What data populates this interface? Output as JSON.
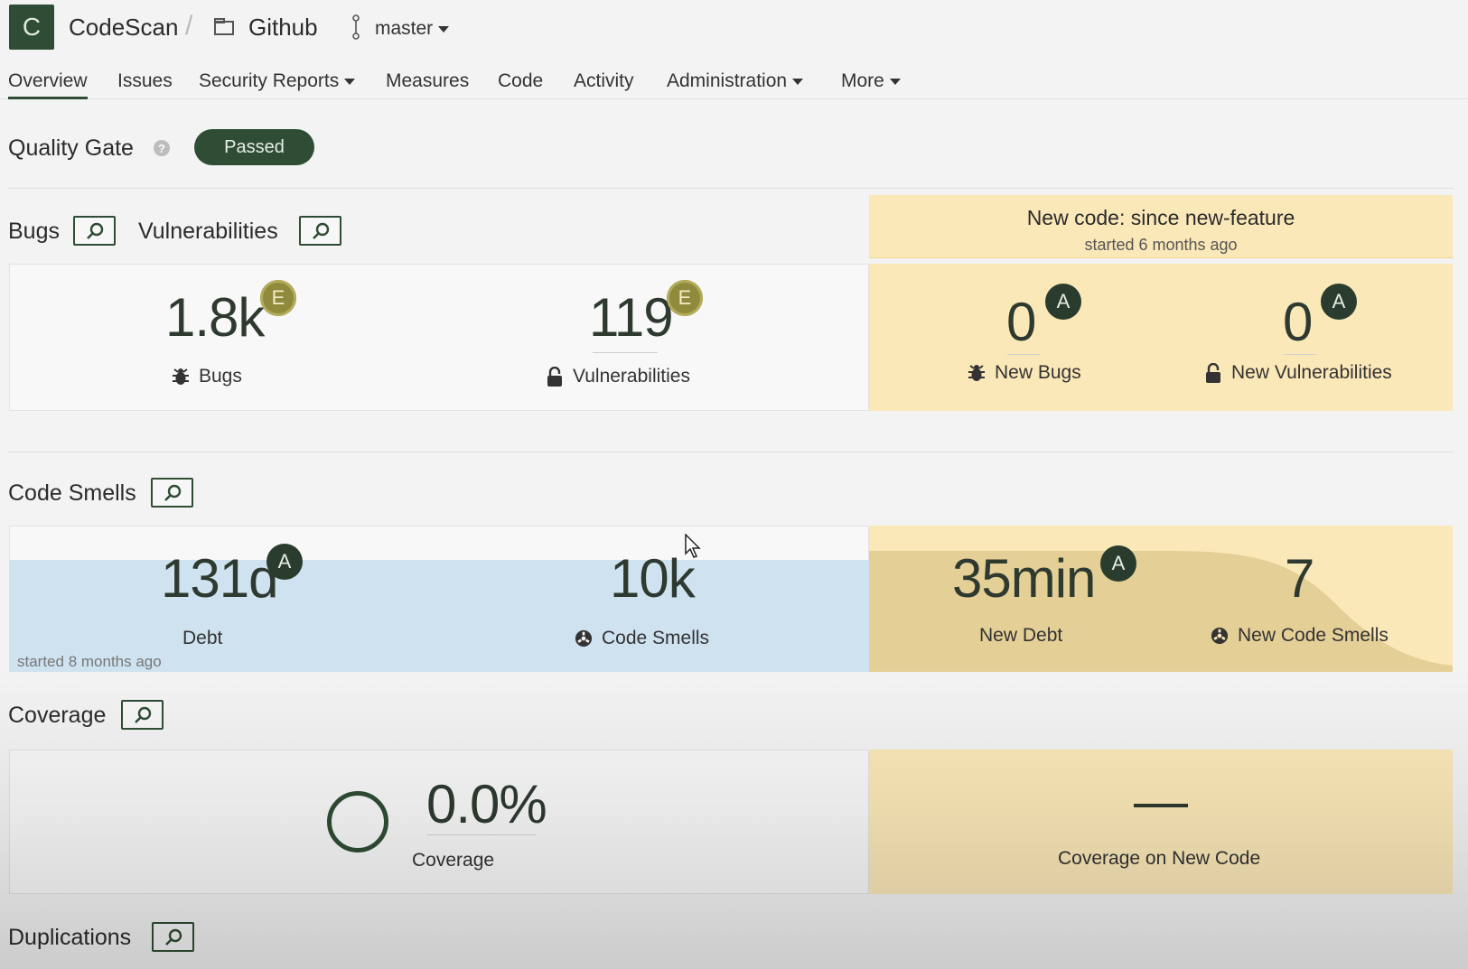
{
  "header": {
    "logo_letter": "C",
    "org": "CodeScan",
    "separator": "/",
    "repo": "Github",
    "branch": "master"
  },
  "nav": {
    "items": [
      {
        "label": "Overview",
        "active": true
      },
      {
        "label": "Issues"
      },
      {
        "label": "Security Reports",
        "dropdown": true
      },
      {
        "label": "Measures"
      },
      {
        "label": "Code"
      },
      {
        "label": "Activity"
      },
      {
        "label": "Administration",
        "dropdown": true
      },
      {
        "label": "More",
        "dropdown": true
      }
    ]
  },
  "quality_gate": {
    "title": "Quality Gate",
    "help": "?",
    "status": "Passed"
  },
  "new_code": {
    "title": "New code: since new-feature",
    "subtitle": "started 6 months ago"
  },
  "bugs_section": {
    "bugs_title": "Bugs",
    "vuln_title": "Vulnerabilities",
    "bugs": {
      "value": "1.8k",
      "rating": "E",
      "label": "Bugs"
    },
    "vulnerabilities": {
      "value": "119",
      "rating": "E",
      "label": "Vulnerabilities"
    },
    "new_bugs": {
      "value": "0",
      "rating": "A",
      "label": "New Bugs"
    },
    "new_vulnerabilities": {
      "value": "0",
      "rating": "A",
      "label": "New Vulnerabilities"
    }
  },
  "smells_section": {
    "title": "Code Smells",
    "debt": {
      "value": "131d",
      "rating": "A",
      "label": "Debt"
    },
    "code_smells": {
      "value": "10k",
      "label": "Code Smells"
    },
    "new_debt": {
      "value": "35min",
      "rating": "A",
      "label": "New Debt"
    },
    "new_code_smells": {
      "value": "7",
      "label": "New Code Smells"
    },
    "started_note": "started 8 months ago"
  },
  "coverage_section": {
    "title": "Coverage",
    "coverage": {
      "value": "0.0%",
      "label": "Coverage"
    },
    "new_coverage": {
      "value": "—",
      "label": "Coverage on New Code"
    }
  },
  "duplications_section": {
    "title": "Duplications"
  },
  "colors": {
    "brand_dark_green": "#2f4d34",
    "new_code_bg": "#fbe8b8",
    "rating_e": "#8f8a3c",
    "rating_a": "#2a3c2d",
    "blue_highlight": "#cfe2f0"
  },
  "icons": {
    "drilldown": "search-icon",
    "bug": "bug-icon",
    "lock": "lock-icon",
    "smell": "smell-icon",
    "repo": "repo-icon",
    "branch": "branch-icon"
  }
}
